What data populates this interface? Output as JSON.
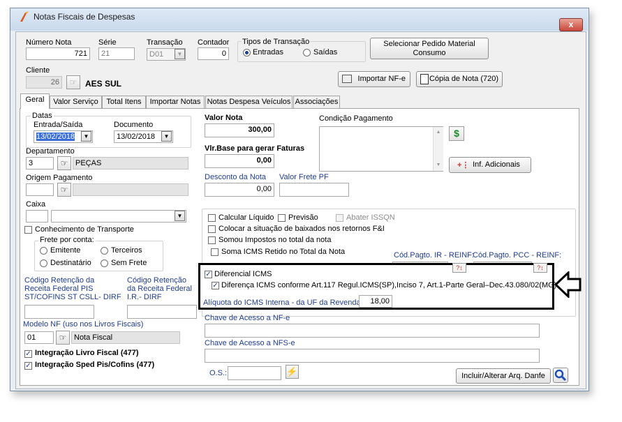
{
  "window": {
    "title": "Notas Fiscais de Despesas",
    "close_label": "x"
  },
  "header": {
    "numero_nota_label": "Número Nota",
    "numero_nota": "721",
    "serie_label": "Série",
    "serie": "21",
    "transacao_label": "Transação",
    "transacao": "D01",
    "contador_label": "Contador",
    "contador": "0",
    "tipos_label": "Tipos de Transação",
    "entradas_label": "Entradas",
    "saidas_label": "Saídas",
    "selecionar_button": "Selecionar Pedido Material Consumo",
    "cliente_label": "Cliente",
    "cliente_codigo": "26",
    "cliente_nome": "AES SUL",
    "importar_button": "Importar NF-e",
    "copia_button": "Cópia de Nota (720)"
  },
  "tabs": [
    "Geral",
    "Valor Serviço",
    "Total Itens",
    "Importar Notas",
    "Notas Despesa Veículos",
    "Associações"
  ],
  "geral": {
    "datas_label": "Datas",
    "entrada_label": "Entrada/Saída",
    "entrada": "13/02/2018",
    "documento_label": "Documento",
    "documento": "13/02/2018",
    "departamento_label": "Departamento",
    "departamento_codigo": "3",
    "departamento_nome": "PEÇAS",
    "origem_label": "Origem Pagamento",
    "caixa_label": "Caixa",
    "conhecimento_label": "Conhecimento de Transporte",
    "frete_label": "Frete por conta:",
    "emitente": "Emitente",
    "terceiros": "Terceiros",
    "destinatario": "Destinatário",
    "sem_frete": "Sem Frete",
    "pis_label": "Código Retenção da Receita Federal PIS ST/COFINS ST CSLL- DIRF",
    "ir_label": "Código Retenção da Receita Federal I.R.- DIRF",
    "modelo_label": "Modelo NF (uso nos Livros Fiscais)",
    "modelo_codigo": "01",
    "modelo_nome": "Nota Fiscal",
    "integracao_livro": "Integração Livro Fiscal (477)",
    "integracao_sped": "Integração Sped Pis/Cofins (477)",
    "valor_nota_label": "Valor Nota",
    "valor_nota": "300,00",
    "base_label": "Vlr.Base para gerar Faturas",
    "base": "0,00",
    "condicao_label": "Condição Pagamento",
    "inf_button": "Inf. Adicionais",
    "desconto_label": "Desconto da Nota",
    "desconto": "0,00",
    "frete_pf_label": "Valor Frete PF",
    "calcular_liquido": "Calcular Líquido",
    "previsao": "Previsão",
    "abater_issqn": "Abater ISSQN",
    "colocar_situacao": "Colocar a situação de baixados nos retornos F&I",
    "somou_impostos": "Somou Impostos no total da nota",
    "soma_icms": "Soma ICMS Retido no Total da Nota",
    "cod_ir_label": "Cód.Pagto. IR - REINF:",
    "cod_pcc_label": "Cód.Pagto. PCC - REINF:",
    "diferencial_icms": "Diferencial ICMS",
    "diferenca_icms": "Diferença ICMS conforme Art.117 Regul.ICMS(SP),Inciso 7, Art.1-Parte Geral–Dec.43.080/02(MG)",
    "aliquota_label": "Alíquota do ICMS Interna - da UF da Revenda",
    "aliquota": "18,00",
    "chave_nfe_label": "Chave de Acesso a NF-e",
    "chave_nfse_label": "Chave de Acesso a NFS-e",
    "os_label": "O.S.:",
    "danfe_button": "Incluir/Alterar Arq. Danfe"
  },
  "colors": {
    "accent": "#1f3d8a",
    "highlight": "#3a6fd8",
    "annotation": "#000000"
  },
  "icons": [
    "app-icon",
    "close-icon",
    "hand-pointer-icon",
    "dollar-icon",
    "lightning-icon",
    "search-icon",
    "arrow-icon"
  ]
}
